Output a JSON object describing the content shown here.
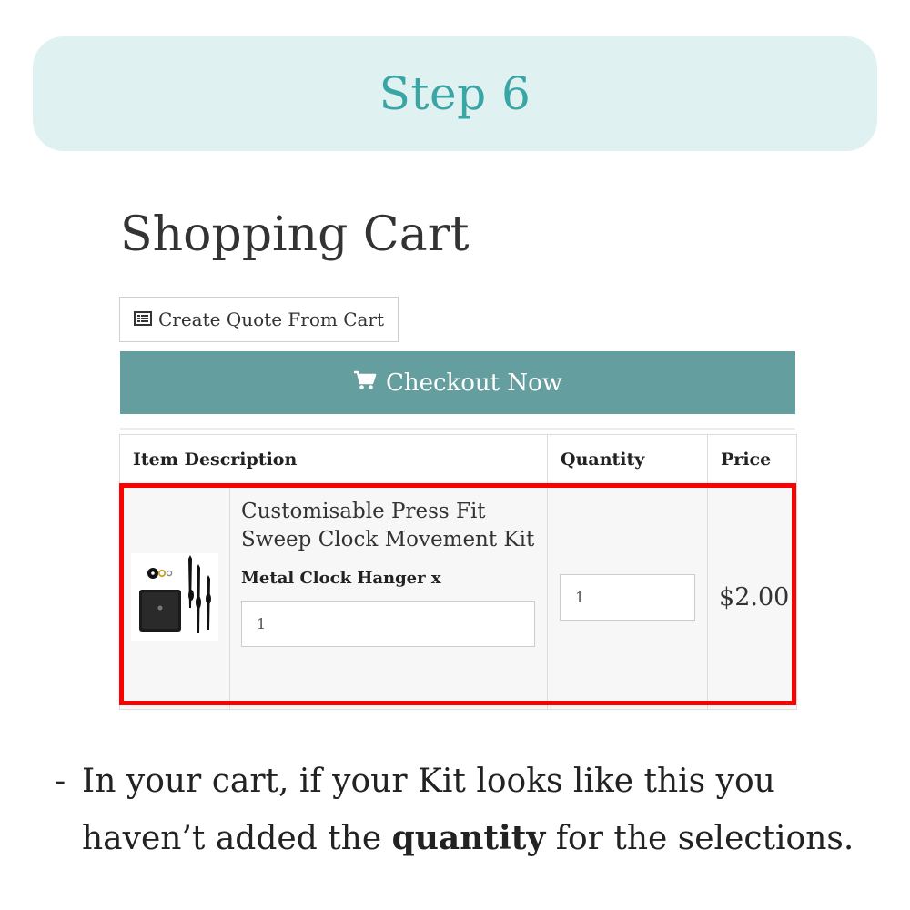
{
  "step": {
    "title": "Step 6"
  },
  "cart": {
    "title": "Shopping Cart",
    "quote_button_label": "Create Quote From Cart",
    "checkout_button_label": "Checkout Now",
    "columns": {
      "description": "Item Description",
      "quantity": "Quantity",
      "price": "Price"
    },
    "item": {
      "name": "Customisable Press Fit Sweep Clock Movement Kit",
      "option_label": "Metal Clock Hanger x",
      "option_value": "1",
      "quantity": "1",
      "price": "$2.00"
    }
  },
  "instruction": {
    "dash": "-",
    "line1": "In your cart, if your Kit looks like this you",
    "line2_before": "haven’t added the ",
    "line2_bold": "quantity",
    "line2_after": " for the selections."
  },
  "colors": {
    "banner_bg": "#e0f1f1",
    "banner_text": "#3aa5a5",
    "checkout_bg": "#649e9f",
    "highlight": "#ff0000"
  },
  "icons": {
    "quote_button": "list-icon",
    "checkout_button": "cart-icon"
  }
}
